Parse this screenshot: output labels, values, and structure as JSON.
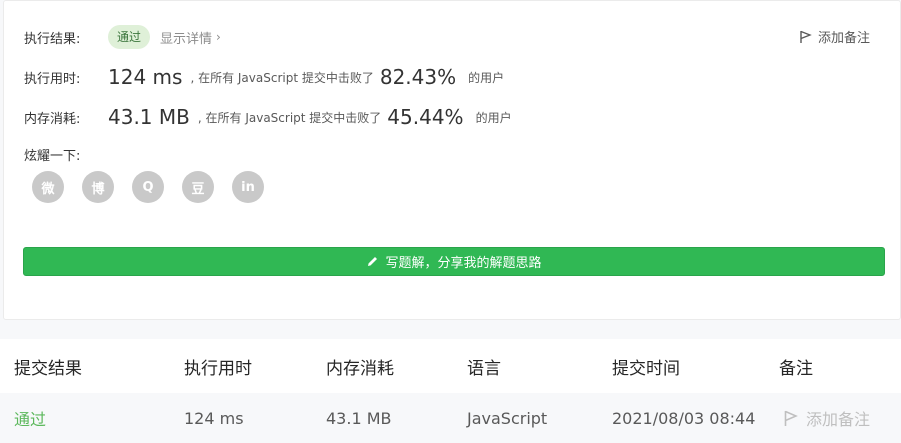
{
  "result": {
    "label": "执行结果:",
    "status": "通过",
    "detail_link": "显示详情",
    "detail_chevron": "›",
    "add_note": "添加备注"
  },
  "runtime": {
    "label": "执行用时:",
    "value": "124 ms",
    "mid": ", 在所有 JavaScript 提交中击败了",
    "percent": "82.43%",
    "tail": "的用户"
  },
  "memory": {
    "label": "内存消耗:",
    "value": "43.1 MB",
    "mid": ", 在所有 JavaScript 提交中击败了",
    "percent": "45.44%",
    "tail": "的用户"
  },
  "share": {
    "label": "炫耀一下:",
    "items": [
      {
        "icon": "wechat-icon",
        "glyph": "微"
      },
      {
        "icon": "weibo-icon",
        "glyph": "博"
      },
      {
        "icon": "qq-icon",
        "glyph": "Q"
      },
      {
        "icon": "douban-icon",
        "glyph": "豆"
      },
      {
        "icon": "linkedin-icon",
        "glyph": "in"
      }
    ]
  },
  "cta": {
    "label": "写题解，分享我的解题思路",
    "color": "#30b854"
  },
  "table": {
    "headers": [
      "提交结果",
      "执行用时",
      "内存消耗",
      "语言",
      "提交时间",
      "备注"
    ],
    "row": {
      "result": "通过",
      "runtime": "124 ms",
      "memory": "43.1 MB",
      "language": "JavaScript",
      "time": "2021/08/03 08:44",
      "note": "添加备注"
    }
  }
}
